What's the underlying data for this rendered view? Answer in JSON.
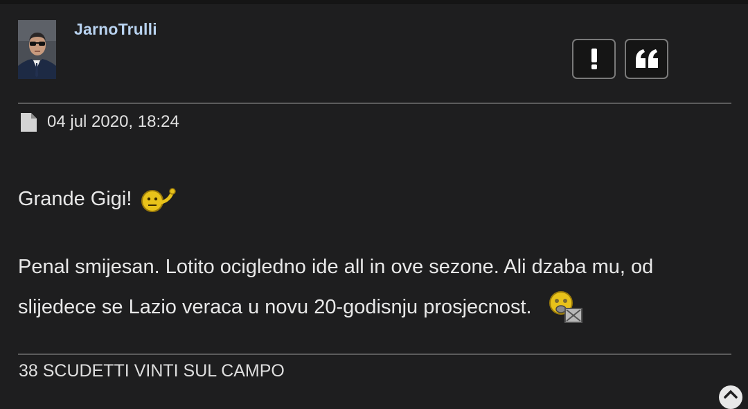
{
  "post": {
    "author": "JarnoTrulli",
    "date": "04 jul 2020, 18:24",
    "body_line1": "Grande Gigi!",
    "body_para2": "Penal smijesan. Lotito ocigledno ide all in ove sezone. Ali dzaba mu, od slijedece se Lazio veraca u novu 20-godisnju prosjecnost.",
    "signature": "38 SCUDETTI VINTI SUL CAMPO"
  },
  "actions": {
    "report_icon": "exclamation-icon",
    "quote_icon": "quote-icon"
  },
  "colors": {
    "background": "#1e1e1f",
    "username": "#b9d3f0",
    "divider": "#5c5c5c",
    "button_border": "#7a7a7a"
  }
}
